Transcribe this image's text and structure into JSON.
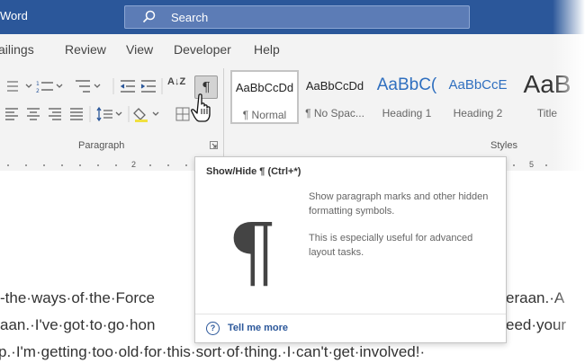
{
  "app": {
    "title": "Word"
  },
  "search": {
    "label": "Search"
  },
  "menu": [
    "ailings",
    "Review",
    "View",
    "Developer",
    "Help"
  ],
  "ribbon": {
    "paragraph_label": "Paragraph",
    "styles_label": "Styles",
    "show_hide_symbol": "¶",
    "sort_label": "A↓Z"
  },
  "styles": [
    {
      "preview": "AaBbCcDd",
      "name": "¶ Normal"
    },
    {
      "preview": "AaBbCcDd",
      "name": "¶ No Spac..."
    },
    {
      "preview": "AaBbC(",
      "name": "Heading 1"
    },
    {
      "preview": "AaBbCcE",
      "name": "Heading 2"
    },
    {
      "preview": "AaB",
      "name": "Title"
    }
  ],
  "ruler": {
    "marks": [
      "2",
      "5"
    ]
  },
  "tooltip": {
    "title": "Show/Hide ¶ (Ctrl+*)",
    "symbol": "¶",
    "desc1": "Show paragraph marks and other hidden formatting symbols.",
    "desc2": "This is especially useful for advanced layout tasks.",
    "more": "Tell me more"
  },
  "document": {
    "lines": [
      "-the·ways·of·the·Force",
      "aan.·I've·got·to·go·hon",
      "p.·I'm·getting·too·old·for·this·sort·of·thing.·I·can't·get·involved!·"
    ],
    "right_fragments": [
      "eraan.·A",
      "eed·your"
    ]
  },
  "colors": {
    "titlebar": "#2b579a",
    "accent": "#2b579a"
  }
}
